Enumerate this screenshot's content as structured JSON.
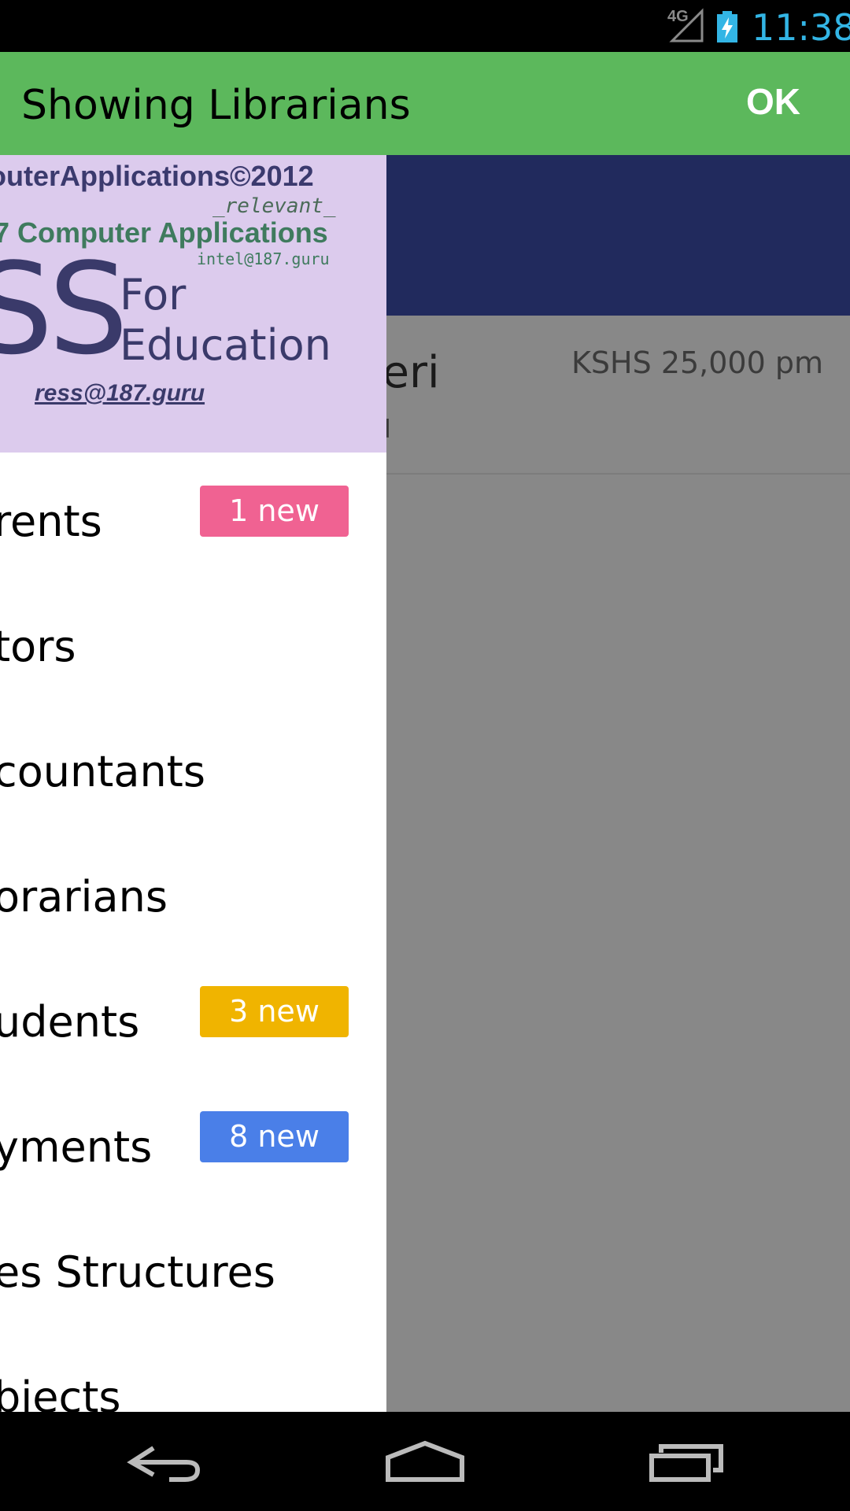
{
  "status_bar": {
    "network": "4G",
    "time": "11:38",
    "clock_color": "#33b5e5"
  },
  "action_bar": {
    "title": "Showing Librarians",
    "ok_label": "OK",
    "color": "#5cb85c"
  },
  "background_list": {
    "banner_color": "#212a5d",
    "row": {
      "name": "jeri",
      "subtitle": "u",
      "salary": "KSHS 25,000 pm"
    }
  },
  "drawer": {
    "header_lines": [
      "outerApplications©2012",
      "_relevant_",
      "7 Computer Applications",
      "intel@187.guru",
      "SS",
      "For",
      "Education",
      "ress@187.guru"
    ],
    "items": [
      {
        "label": "rents",
        "badge": "1 new",
        "badge_color": "#f06292"
      },
      {
        "label": "tors",
        "badge": "",
        "badge_color": ""
      },
      {
        "label": "countants",
        "badge": "",
        "badge_color": ""
      },
      {
        "label": "orarians",
        "badge": "",
        "badge_color": ""
      },
      {
        "label": "udents",
        "badge": "3 new",
        "badge_color": "#f0b400"
      },
      {
        "label": "yments",
        "badge": "8 new",
        "badge_color": "#4a7fe8"
      },
      {
        "label": "es Structures",
        "badge": "",
        "badge_color": ""
      },
      {
        "label": "bjects",
        "badge": "",
        "badge_color": ""
      }
    ]
  },
  "nav_bar": {
    "buttons": [
      "back-icon",
      "home-icon",
      "recents-icon"
    ]
  }
}
